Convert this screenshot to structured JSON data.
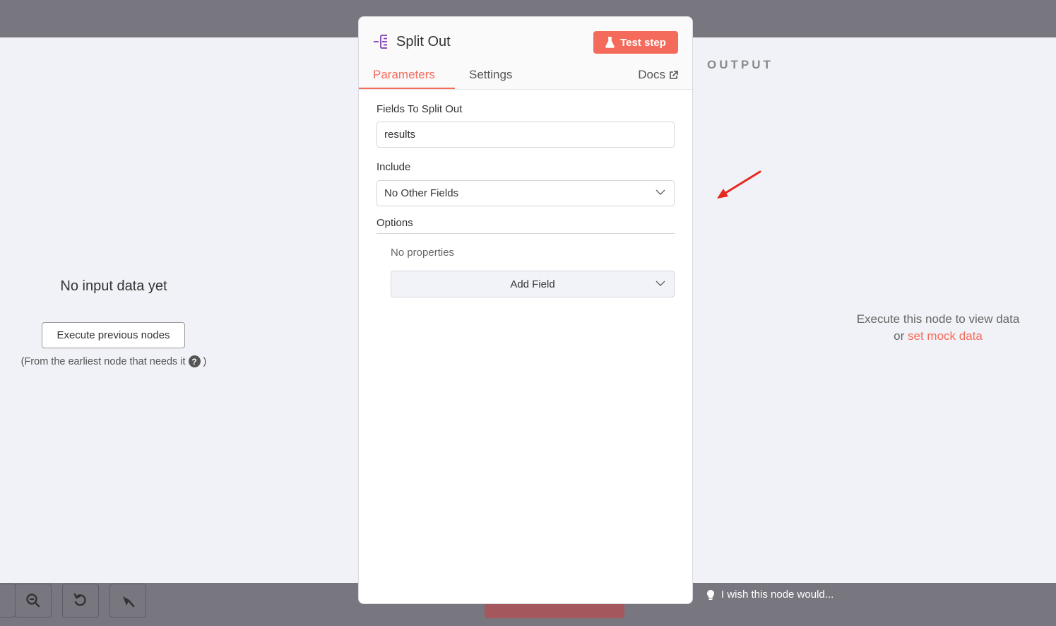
{
  "node": {
    "title": "Split Out",
    "test_button_label": "Test step",
    "tabs": [
      {
        "label": "Parameters",
        "active": true
      },
      {
        "label": "Settings",
        "active": false
      }
    ],
    "docs_label": "Docs"
  },
  "params": {
    "fields_label": "Fields To Split Out",
    "fields_value": "results",
    "include_label": "Include",
    "include_value": "No Other Fields",
    "options_label": "Options",
    "no_properties": "No properties",
    "add_field_label": "Add Field"
  },
  "input": {
    "title": "No input data yet",
    "execute_button": "Execute previous nodes",
    "hint": "(From the earliest node that needs it",
    "hint_end": ")"
  },
  "output": {
    "label": "OUTPUT",
    "message": "Execute this node to view data",
    "or": "or",
    "mock_link": "set mock data"
  },
  "feedback": "I wish this node would...",
  "colors": {
    "accent": "#f56b5b",
    "node_icon": "#8b4fb8"
  }
}
